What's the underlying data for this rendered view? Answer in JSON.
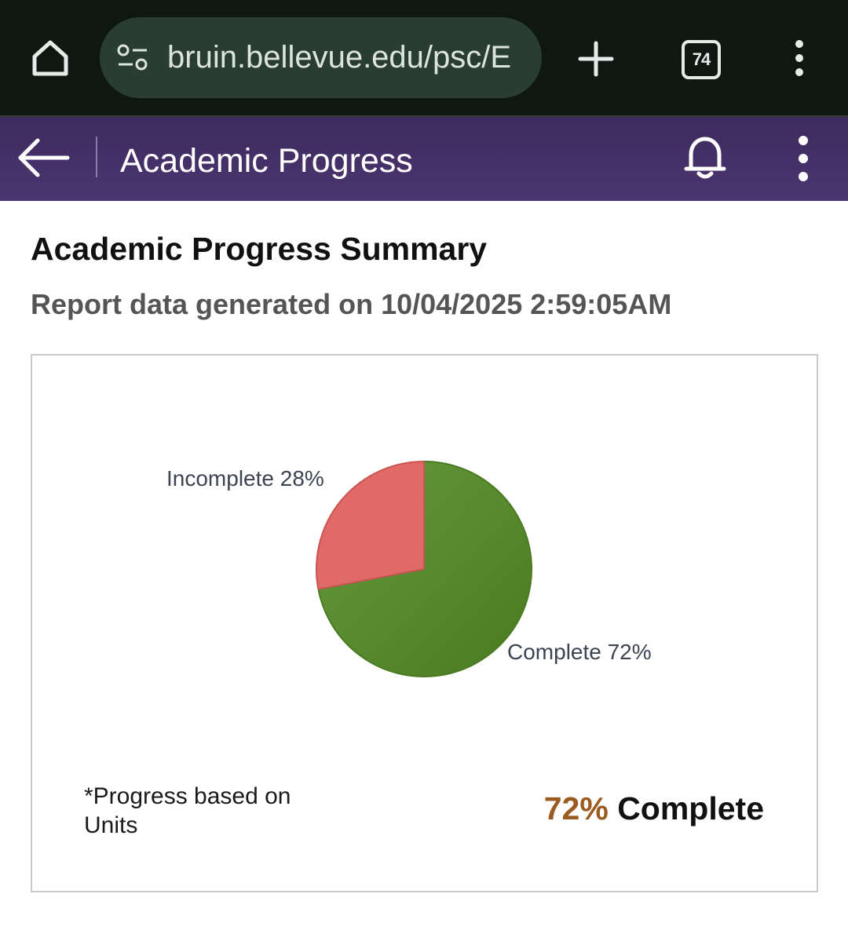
{
  "browser": {
    "url": "bruin.bellevue.edu/psc/E",
    "tab_count": "74",
    "icons": [
      "home-icon",
      "site-info-icon",
      "plus-icon",
      "tabs-icon",
      "kebab-menu-icon"
    ]
  },
  "header": {
    "title": "Academic Progress",
    "icons": [
      "back-arrow-icon",
      "bell-icon",
      "kebab-menu-icon"
    ],
    "colors": {
      "gradient_top": "#3e2a5d",
      "gradient_bottom": "#4b3570"
    }
  },
  "main": {
    "title": "Academic Progress Summary",
    "report_generated": "Report data generated on 10/04/2025 2:59:05AM",
    "footnote": "*Progress based on Units",
    "complete_percent": "72%",
    "complete_label": "Complete"
  },
  "chart_data": {
    "type": "pie",
    "slices": [
      {
        "label": "Complete 72%",
        "value": 72,
        "color": "#55882c"
      },
      {
        "label": "Incomplete 28%",
        "value": 28,
        "color": "#e06a68"
      }
    ]
  }
}
